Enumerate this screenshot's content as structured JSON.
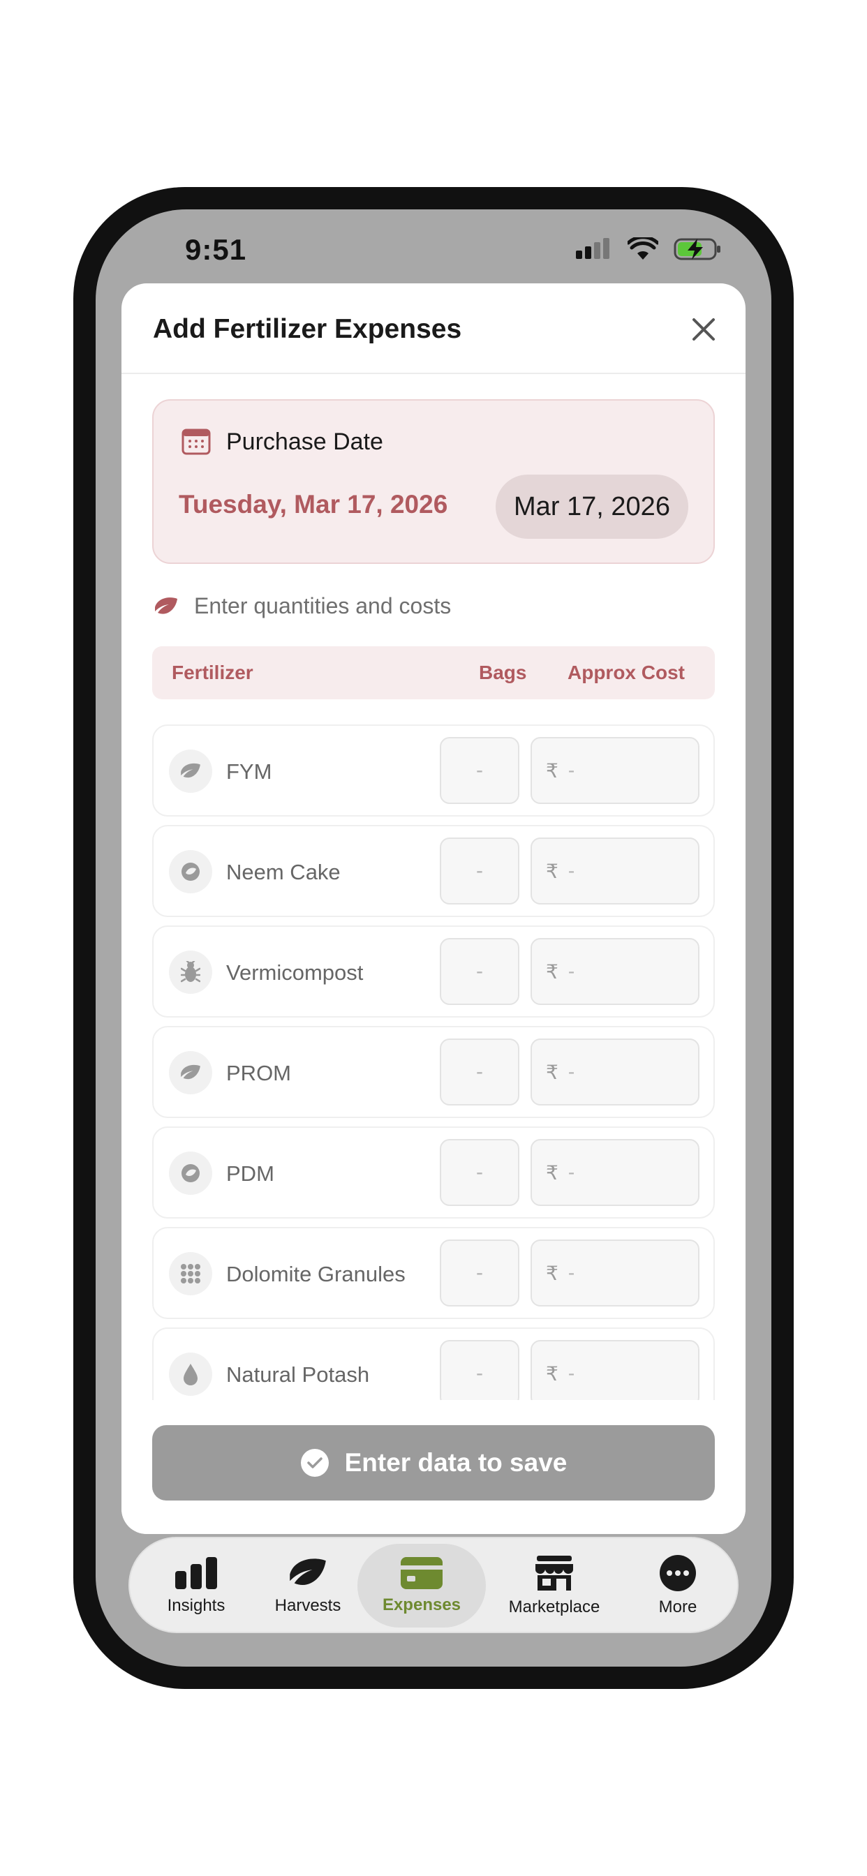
{
  "status_bar": {
    "time": "9:51"
  },
  "sheet": {
    "title": "Add Fertilizer Expenses"
  },
  "purchase_date": {
    "label": "Purchase Date",
    "long_date": "Tuesday, Mar 17, 2026",
    "short_date": "Mar 17, 2026"
  },
  "section_hint": "Enter quantities and costs",
  "table": {
    "headers": {
      "name": "Fertilizer",
      "bags": "Bags",
      "cost": "Approx Cost"
    },
    "currency_symbol": "₹",
    "empty_value": "-",
    "rows": [
      {
        "name": "FYM",
        "icon": "leaf-icon"
      },
      {
        "name": "Neem Cake",
        "icon": "seed-icon"
      },
      {
        "name": "Vermicompost",
        "icon": "bug-icon"
      },
      {
        "name": "PROM",
        "icon": "leaf-icon"
      },
      {
        "name": "PDM",
        "icon": "seed-icon"
      },
      {
        "name": "Dolomite Granules",
        "icon": "grid-dots-icon"
      },
      {
        "name": "Natural Potash",
        "icon": "drop-icon"
      }
    ]
  },
  "save_button": {
    "label": "Enter data to save"
  },
  "tabs": [
    {
      "label": "Insights",
      "icon": "chart-bar-icon"
    },
    {
      "label": "Harvests",
      "icon": "leaf-icon"
    },
    {
      "label": "Expenses",
      "icon": "card-icon",
      "active": true
    },
    {
      "label": "Marketplace",
      "icon": "store-icon"
    },
    {
      "label": "More",
      "icon": "more-dots-icon"
    }
  ],
  "colors": {
    "accent": "#b05a5f",
    "accent_bg": "#f7eced",
    "active_tab": "#6e8a30",
    "disabled_button": "#9b9b9b"
  }
}
